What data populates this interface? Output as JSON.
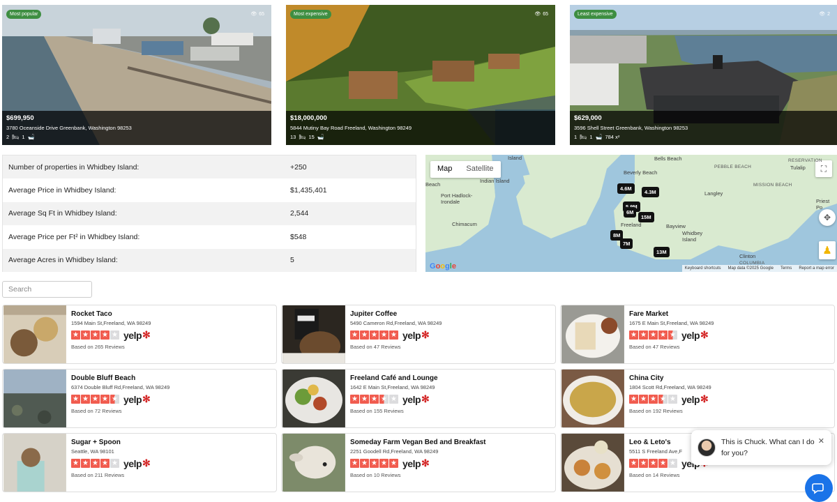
{
  "listings": [
    {
      "badge": "Most popular",
      "views": "65",
      "price": "$699,950",
      "address": "3780 Oceanside Drive Greenbank, Washington 98253",
      "beds": "2",
      "baths": "1",
      "sqft": ""
    },
    {
      "badge": "Most expensive",
      "views": "65",
      "price": "$18,000,000",
      "address": "5844 Mutiny Bay Road Freeland, Washington 98249",
      "beds": "13",
      "baths": "15",
      "sqft": ""
    },
    {
      "badge": "Least expensive",
      "views": "2",
      "price": "$629,000",
      "address": "3596 Shell Street Greenbank, Washington 98253",
      "beds": "1",
      "baths": "1",
      "sqft": "784 x²"
    }
  ],
  "stats": [
    {
      "label": "Number of properties in Whidbey Island:",
      "value": "+250"
    },
    {
      "label": "Average Price in Whidbey Island:",
      "value": "$1,435,401"
    },
    {
      "label": "Average Sq Ft in Whidbey Island:",
      "value": "2,544"
    },
    {
      "label": "Average Price per Ft² in Whidbey Island:",
      "value": "$548"
    },
    {
      "label": "Average Acres in Whidbey Island:",
      "value": "5"
    }
  ],
  "map": {
    "tab_map": "Map",
    "tab_satellite": "Satellite",
    "places": [
      "Bells Beach",
      "Beverly Beach",
      "PEBBLE BEACH",
      "RESERVATION",
      "Tulalip",
      "Island",
      "Indian Island",
      "Beach",
      "Port Hadlock-Irondale",
      "Chimacum",
      "Langley",
      "MISSION BEACH",
      "Priest Po",
      "Freeland",
      "Bayview",
      "Whidbey Island",
      "Clinton",
      "COLUMBIA"
    ],
    "pins": [
      "4.6M",
      "4.3M",
      "5.9M",
      "6M",
      "15M",
      "8M",
      "7M",
      "13M"
    ],
    "footer": [
      "Keyboard shortcuts",
      "Map data ©2025 Google",
      "Terms",
      "Report a map error"
    ],
    "logo": "Google"
  },
  "search": {
    "placeholder": "Search"
  },
  "businesses": [
    {
      "name": "Rocket Taco",
      "address": "1594 Main St,Freeland, WA 98249",
      "rating": 4,
      "reviews": "Based on 265 Reviews"
    },
    {
      "name": "Jupiter Coffee",
      "address": "5490 Cameron Rd,Freeland, WA 98249",
      "rating": 5,
      "reviews": "Based on 47 Reviews"
    },
    {
      "name": "Fare Market",
      "address": "1675 E Main St,Freeland, WA 98249",
      "rating": 4.5,
      "reviews": "Based on 47 Reviews"
    },
    {
      "name": "Double Bluff Beach",
      "address": "6374 Double Bluff Rd,Freeland, WA 98249",
      "rating": 4.5,
      "reviews": "Based on 72 Reviews"
    },
    {
      "name": "Freeland Café and Lounge",
      "address": "1642 E Main St,Freeland, WA 98249",
      "rating": 3.5,
      "reviews": "Based on 155 Reviews"
    },
    {
      "name": "China City",
      "address": "1804 Scott Rd,Freeland, WA 98249",
      "rating": 3.5,
      "reviews": "Based on 192 Reviews"
    },
    {
      "name": "Sugar + Spoon",
      "address": "Seattle, WA 98101",
      "rating": 4,
      "reviews": "Based on 211 Reviews"
    },
    {
      "name": "Someday Farm Vegan Bed and Breakfast",
      "address": "2251 Goodell Rd,Freeland, WA 98249",
      "rating": 5,
      "reviews": "Based on 10 Reviews"
    },
    {
      "name": "Leo & Leto's",
      "address": "5511 S Freeland Ave,F",
      "rating": 4,
      "reviews": "Based on 14 Reviews"
    }
  ],
  "yelp_label": "yelp",
  "chat": {
    "message": "This is Chuck. What can I do for you?"
  },
  "colors": {
    "badge": "#3e8e41",
    "yelp_star": "#f15c4f",
    "chat": "#1a73e8"
  }
}
